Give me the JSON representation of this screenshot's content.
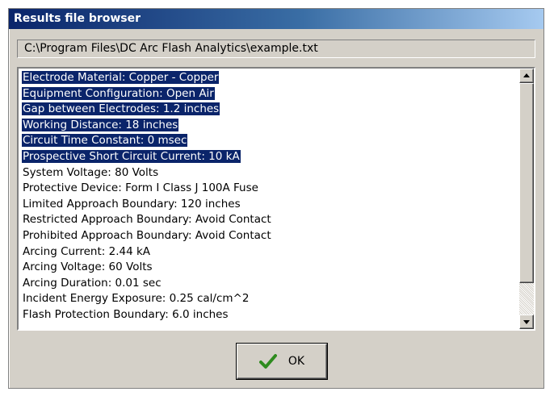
{
  "window": {
    "title": "Results file browser"
  },
  "path": "C:\\Program Files\\DC Arc Flash Analytics\\example.txt",
  "lines": [
    {
      "text": "Electrode Material: Copper - Copper",
      "selected": true
    },
    {
      "text": "Equipment Configuration: Open Air",
      "selected": true
    },
    {
      "text": "Gap between Electrodes: 1.2 inches",
      "selected": true
    },
    {
      "text": "Working Distance: 18 inches",
      "selected": true
    },
    {
      "text": "Circuit Time Constant: 0 msec",
      "selected": true
    },
    {
      "text": "Prospective Short Circuit Current: 10 kA",
      "selected": true
    },
    {
      "text": "System Voltage: 80 Volts",
      "selected": false
    },
    {
      "text": "Protective Device: Form I Class J 100A Fuse",
      "selected": false
    },
    {
      "text": "Limited Approach Boundary: 120 inches",
      "selected": false
    },
    {
      "text": "Restricted Approach Boundary: Avoid Contact",
      "selected": false
    },
    {
      "text": "Prohibited Approach Boundary: Avoid Contact",
      "selected": false
    },
    {
      "text": "Arcing Current: 2.44 kA",
      "selected": false
    },
    {
      "text": "Arcing Voltage: 60 Volts",
      "selected": false
    },
    {
      "text": "Arcing Duration: 0.01 sec",
      "selected": false
    },
    {
      "text": "Incident Energy Exposure: 0.25 cal/cm^2",
      "selected": false
    },
    {
      "text": "Flash Protection Boundary: 6.0 inches",
      "selected": false
    }
  ],
  "ok_button": {
    "label": "OK",
    "icon": "check-icon"
  },
  "colors": {
    "title_bar": "#0a246a",
    "selection": "#0a246a",
    "dialog_face": "#d4d0c8",
    "check": "#2e8b1e"
  }
}
